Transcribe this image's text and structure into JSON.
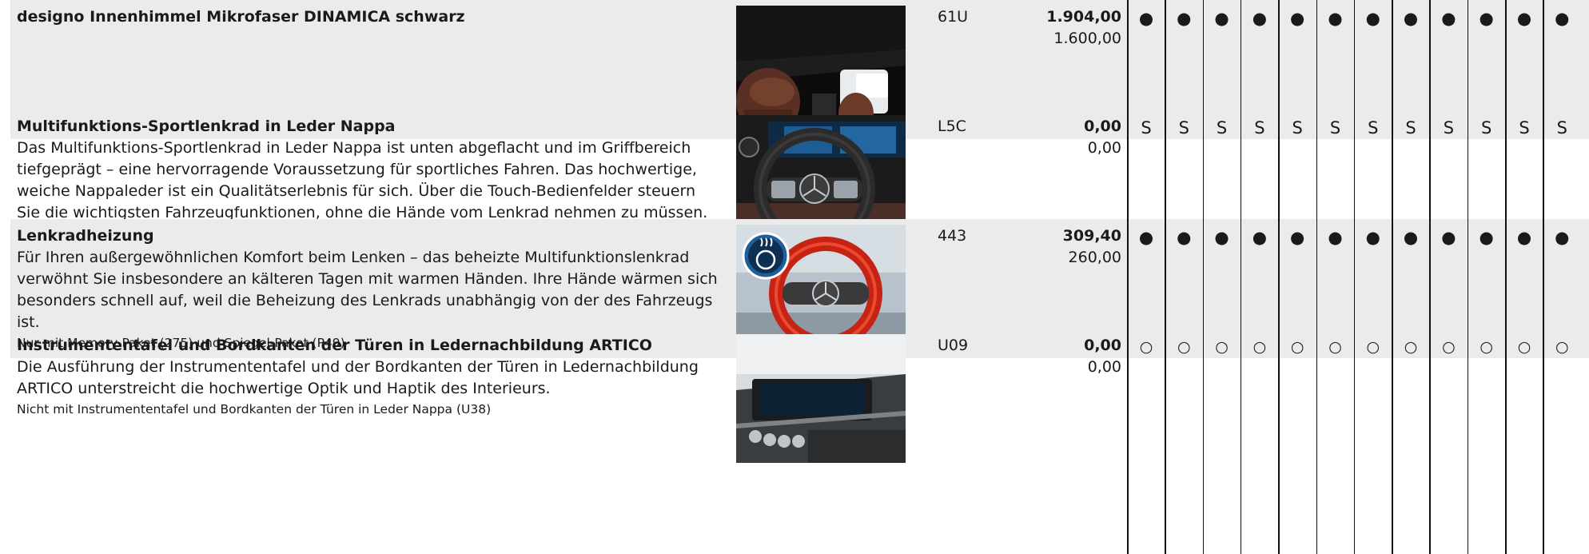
{
  "rows": [
    {
      "title": "designo Innenhimmel Mikrofaser DINAMICA schwarz",
      "body": "",
      "note": "",
      "code": "61U",
      "price_gross": "1.904,00",
      "price_net": "1.600,00",
      "availability": [
        "●",
        "●",
        "●",
        "●",
        "●",
        "●",
        "●",
        "●",
        "●",
        "●",
        "●",
        "●"
      ],
      "image": "black-headliner-interior-photo"
    },
    {
      "title": "Multifunktions-Sportlenkrad in Leder Nappa",
      "body": "Das Multifunktions-Sportlenkrad in Leder Nappa ist unten abgeflacht und im Griffbereich tiefgeprägt – eine hervorragende Voraussetzung für sportliches Fahren. Das hochwertige, weiche Nappaleder ist ein Qualitätserlebnis für sich. Über die Touch-Bedienfelder steuern Sie die wichtigsten Fahrzeug­funktionen, ohne die Hände vom Lenkrad nehmen zu müssen.",
      "note": "",
      "code": "L5C",
      "price_gross": "0,00",
      "price_net": "0,00",
      "availability": [
        "S",
        "S",
        "S",
        "S",
        "S",
        "S",
        "S",
        "S",
        "S",
        "S",
        "S",
        "S"
      ],
      "image": "sport-steering-wheel-photo"
    },
    {
      "title": "Lenkradheizung",
      "body": "Für Ihren außergewöhnlichen Komfort beim Lenken – das beheizte Multifunktionslenkrad verwöhnt Sie insbesondere an kälteren Tagen mit warmen Händen. Ihre Hände wärmen sich besonders schnell auf, weil die Beheizung des Lenkrads unabhängig von der des Fahrzeugs ist.",
      "note": "Nur mit Memory-Paket (275) und Spiegel-Paket (P49)",
      "code": "443",
      "price_gross": "309,40",
      "price_net": "260,00",
      "availability": [
        "●",
        "●",
        "●",
        "●",
        "●",
        "●",
        "●",
        "●",
        "●",
        "●",
        "●",
        "●"
      ],
      "image": "heated-steering-wheel-photo"
    },
    {
      "title": "Instrumententafel und Bordkanten der Türen in Ledernachbildung ARTICO",
      "body": "Die Ausführung der Instrumententafel und der Bordkanten der Türen in Ledernachbildung ARTICO unterstreicht die hochwertige Optik und Haptik des Interieurs.",
      "note": "Nicht mit Instrumententafel und Bordkanten der Türen in Leder Nappa (U38)",
      "code": "U09",
      "price_gross": "0,00",
      "price_net": "0,00",
      "availability": [
        "○",
        "○",
        "○",
        "○",
        "○",
        "○",
        "○",
        "○",
        "○",
        "○",
        "○",
        "○"
      ],
      "image": "dashboard-artico-photo"
    }
  ],
  "colors": {
    "row_shade": "#ebebeb",
    "rule": "#111111",
    "heat": "#d8331f",
    "badge": "#2a8fd6"
  }
}
